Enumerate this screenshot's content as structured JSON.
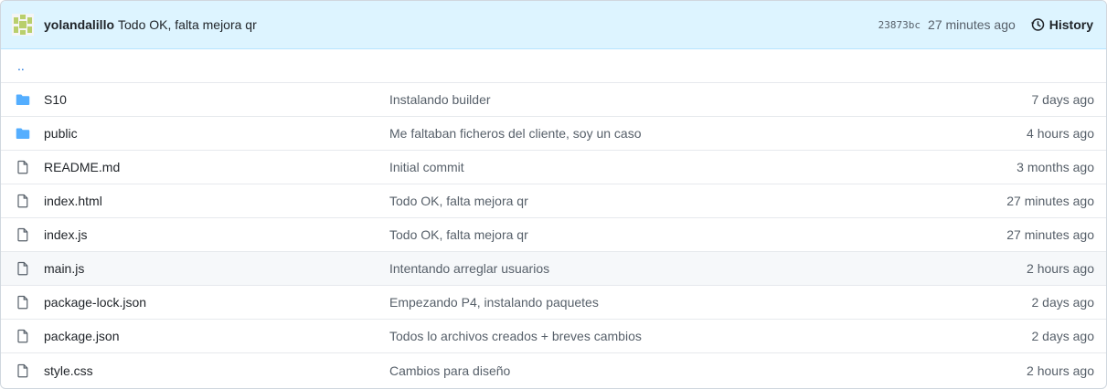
{
  "latest_commit": {
    "author": "yolandalillo",
    "message": "Todo OK, falta mejora qr",
    "sha": "23873bc",
    "time_ago": "27 minutes ago",
    "history_label": "History"
  },
  "parent_dir_label": "..",
  "files": [
    {
      "type": "folder",
      "icon": "folder-icon",
      "name": "S10",
      "message": "Instalando builder",
      "time": "7 days ago"
    },
    {
      "type": "folder",
      "icon": "folder-icon",
      "name": "public",
      "message": "Me faltaban ficheros del cliente, soy un caso",
      "time": "4 hours ago"
    },
    {
      "type": "file",
      "icon": "file-icon",
      "name": "README.md",
      "message": "Initial commit",
      "time": "3 months ago"
    },
    {
      "type": "file",
      "icon": "file-icon",
      "name": "index.html",
      "message": "Todo OK, falta mejora qr",
      "time": "27 minutes ago"
    },
    {
      "type": "file",
      "icon": "file-icon",
      "name": "index.js",
      "message": "Todo OK, falta mejora qr",
      "time": "27 minutes ago"
    },
    {
      "type": "file",
      "icon": "file-icon",
      "name": "main.js",
      "message": "Intentando arreglar usuarios",
      "time": "2 hours ago"
    },
    {
      "type": "file",
      "icon": "file-icon",
      "name": "package-lock.json",
      "message": "Empezando P4, instalando paquetes",
      "time": "2 days ago"
    },
    {
      "type": "file",
      "icon": "file-icon",
      "name": "package.json",
      "message": "Todos lo archivos creados + breves cambios",
      "time": "2 days ago"
    },
    {
      "type": "file",
      "icon": "file-icon",
      "name": "style.css",
      "message": "Cambios para diseño",
      "time": "2 hours ago"
    }
  ],
  "colors": {
    "header_bg": "#ddf4ff",
    "folder": "#54aeff",
    "file_icon": "#57606a",
    "link": "#0969da"
  }
}
